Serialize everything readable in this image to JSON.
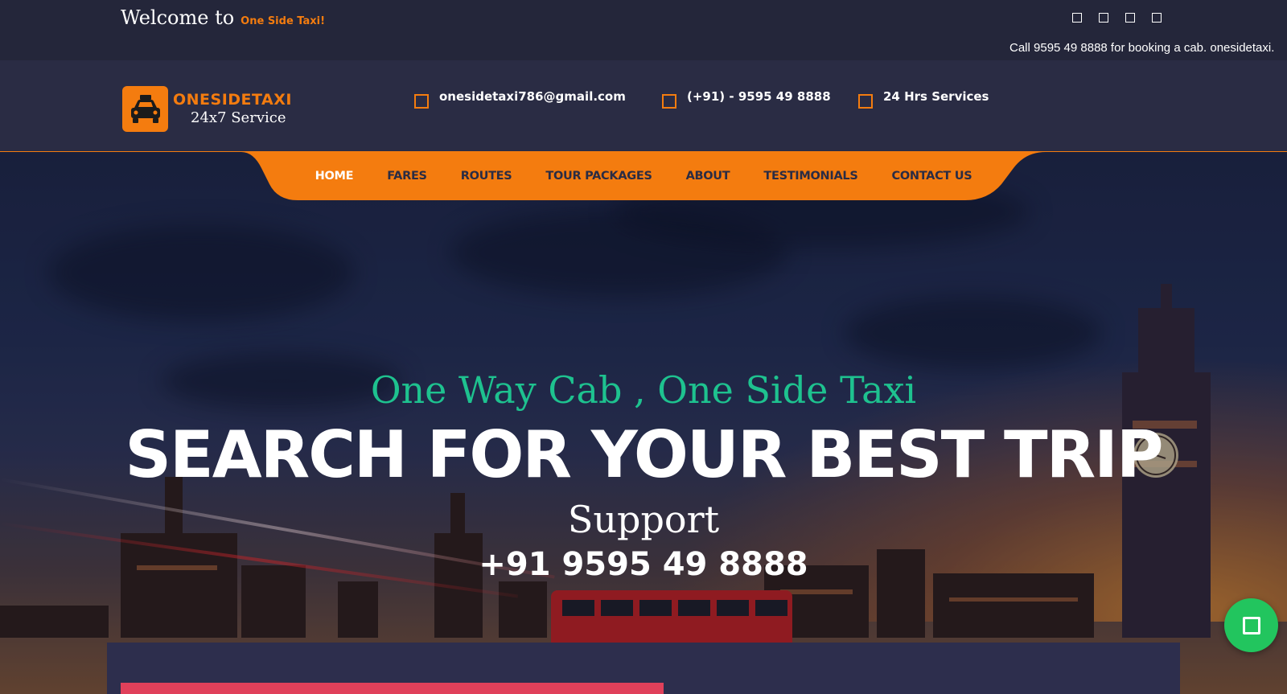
{
  "topbar": {
    "welcome_text": "Welcome to",
    "welcome_brand": "One Side Taxi!",
    "social_icons": [
      "facebook-icon",
      "twitter-icon",
      "instagram-icon",
      "youtube-icon"
    ],
    "marquee_text": "Call 9595 49 8888 for booking a cab. onesidetaxi."
  },
  "header": {
    "logo_title": "ONESIDETAXI",
    "logo_subtitle": "24x7 Service",
    "email": "onesidetaxi786@gmail.com",
    "phone": "(+91) - 9595 49 8888",
    "services": "24 Hrs Services"
  },
  "nav": {
    "items": [
      {
        "label": "HOME"
      },
      {
        "label": "FARES"
      },
      {
        "label": "ROUTES"
      },
      {
        "label": "TOUR PACKAGES"
      },
      {
        "label": "ABOUT"
      },
      {
        "label": "TESTIMONIALS"
      },
      {
        "label": "CONTACT US"
      }
    ]
  },
  "hero": {
    "tagline": "One Way Cab , One Side Taxi",
    "headline": "SEARCH FOR YOUR BEST TRIP",
    "support_label": "Support",
    "support_phone": "+91 9595 49 8888"
  },
  "colors": {
    "accent": "#f47c0f",
    "tagline_green": "#1ec28f",
    "fab_green": "#22c55e",
    "panel": "#2d2e4d",
    "panel_bar": "#e0405a"
  }
}
